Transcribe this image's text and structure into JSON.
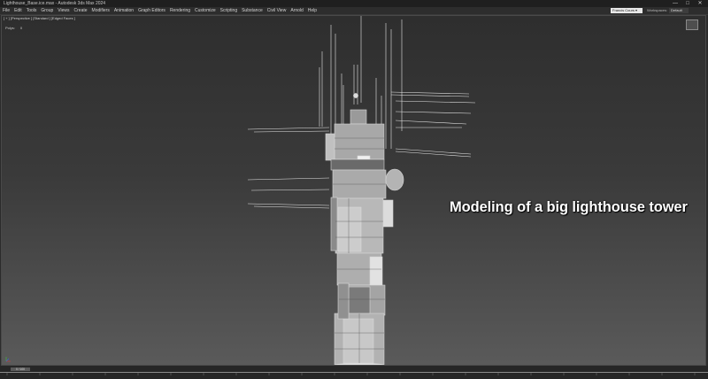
{
  "window": {
    "title": "Lighthouse_Base.ice.max - Autodesk 3ds Max 2024",
    "controls": [
      "—",
      "□",
      "✕"
    ]
  },
  "menu": {
    "items": [
      "File",
      "Edit",
      "Tools",
      "Group",
      "Views",
      "Create",
      "Modifiers",
      "Animation",
      "Graph Editors",
      "Rendering",
      "Customize",
      "Scripting",
      "Substance",
      "Civil View",
      "Arnold",
      "Help"
    ],
    "signin": "Francis Cours ▾",
    "workspace_label": "Workspaces:",
    "workspace_value": "Default"
  },
  "viewport": {
    "label": "[ + ] [Perspective ] [Standard ] [Edged Faces ]",
    "stat_label": "Polys:",
    "stat_value": "0",
    "overlay_text": "Modeling of a big lighthouse tower"
  },
  "timeline": {
    "slider_label": "0 / 100"
  },
  "colors": {
    "ui_dark": "#262626",
    "viewport_top": "#2e2e2e",
    "viewport_bottom": "#5a5a5a",
    "wire": "#e6e6e6",
    "panel": "#cfcfcf"
  }
}
